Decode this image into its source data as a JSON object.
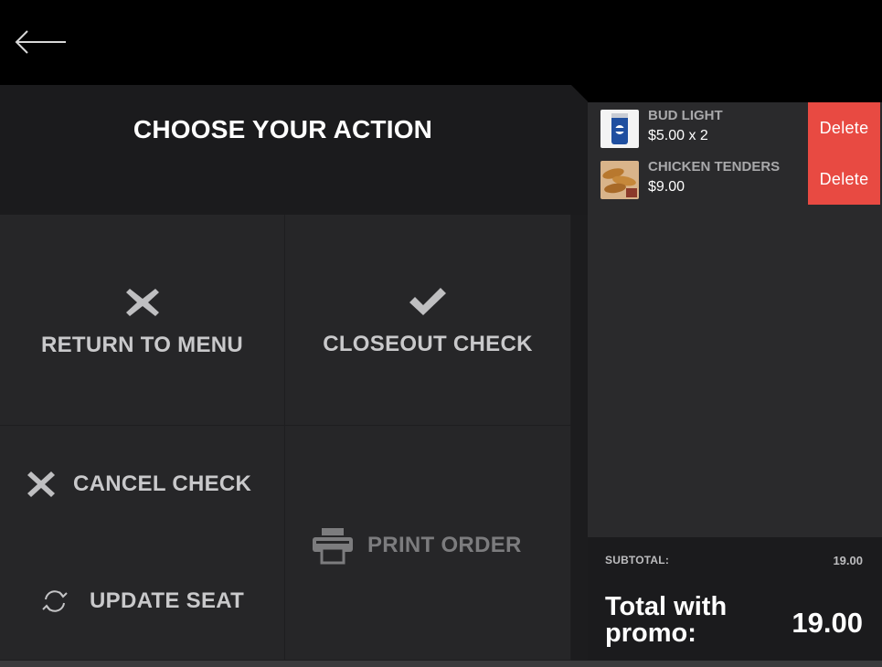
{
  "nav": {
    "back_icon": "arrow-left-icon"
  },
  "header": {
    "title": "CHOOSE YOUR ACTION"
  },
  "actions": {
    "return_to_menu": {
      "label": "RETURN TO MENU",
      "icon": "x-icon"
    },
    "closeout_check": {
      "label": "CLOSEOUT CHECK",
      "icon": "checkmark-icon"
    },
    "cancel_check": {
      "label": "CANCEL CHECK",
      "icon": "x-icon"
    },
    "update_seat": {
      "label": "UPDATE SEAT",
      "icon": "refresh-icon"
    },
    "print_order": {
      "label": "PRINT ORDER",
      "icon": "printer-icon"
    }
  },
  "order": {
    "items": [
      {
        "name": "BUD LIGHT",
        "price": "$5.00 x 2",
        "delete_label": "Delete",
        "thumb": "beer-can-image"
      },
      {
        "name": "CHICKEN TENDERS",
        "price": "$9.00",
        "delete_label": "Delete",
        "thumb": "chicken-tenders-image"
      }
    ],
    "subtotal_label": "SUBTOTAL:",
    "subtotal_value": "19.00",
    "total_label": "Total with promo:",
    "total_value": "19.00"
  },
  "colors": {
    "delete": "#e84a42",
    "panel_bg": "#262628",
    "header_bg": "#1b1b1d",
    "order_bg": "#2a2a2c",
    "action_text": "#c9c9cb"
  }
}
